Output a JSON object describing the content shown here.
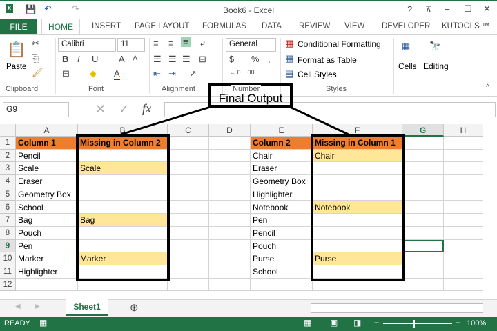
{
  "window": {
    "title": "Book6 - Excel",
    "help": "?",
    "minimize": "–",
    "maximize": "☐",
    "close": "✕"
  },
  "tabs": [
    "FILE",
    "HOME",
    "INSERT",
    "PAGE LAYOUT",
    "FORMULAS",
    "DATA",
    "REVIEW",
    "VIEW",
    "DEVELOPER",
    "KUTOOLS ™"
  ],
  "ribbon": {
    "paste": "Paste",
    "font_name": "Calibri",
    "font_size": "11",
    "number_format": "General",
    "conditional_formatting": "Conditional Formatting",
    "format_as_table": "Format as Table",
    "cell_styles": "Cell Styles",
    "cells": "Cells",
    "editing": "Editing",
    "groups": [
      "Clipboard",
      "Font",
      "Alignment",
      "Number",
      "Styles"
    ]
  },
  "formula_bar": {
    "name_box": "G9",
    "fx": "fx",
    "value": ""
  },
  "annotation": "Final Output",
  "columns": [
    "A",
    "B",
    "C",
    "D",
    "E",
    "F",
    "G",
    "H"
  ],
  "rows": [
    "1",
    "2",
    "3",
    "4",
    "5",
    "6",
    "7",
    "8",
    "9",
    "10",
    "11",
    "12"
  ],
  "col_a": [
    "Column 1",
    "Pencil",
    "Scale",
    "Eraser",
    "Geometry Box",
    "School",
    "Bag",
    "Pouch",
    "Pen",
    "Marker",
    "Highlighter"
  ],
  "col_b": [
    "Missing in Column 2",
    "",
    "Scale",
    "",
    "",
    "",
    "Bag",
    "",
    "",
    "Marker",
    ""
  ],
  "col_e": [
    "Column 2",
    "Chair",
    "Eraser",
    "Geometry Box",
    "Highlighter",
    "Notebook",
    "Pen",
    "Pencil",
    "Pouch",
    "Purse",
    "School"
  ],
  "col_f": [
    "Missing in Column 1",
    "Chair",
    "",
    "",
    "",
    "Notebook",
    "",
    "",
    "",
    "Purse",
    ""
  ],
  "sheet_tab": "Sheet1",
  "status": {
    "mode": "READY",
    "zoom": "100%"
  },
  "colors": {
    "accent": "#217346",
    "header": "#ed7d31",
    "highlight": "#ffe699"
  }
}
